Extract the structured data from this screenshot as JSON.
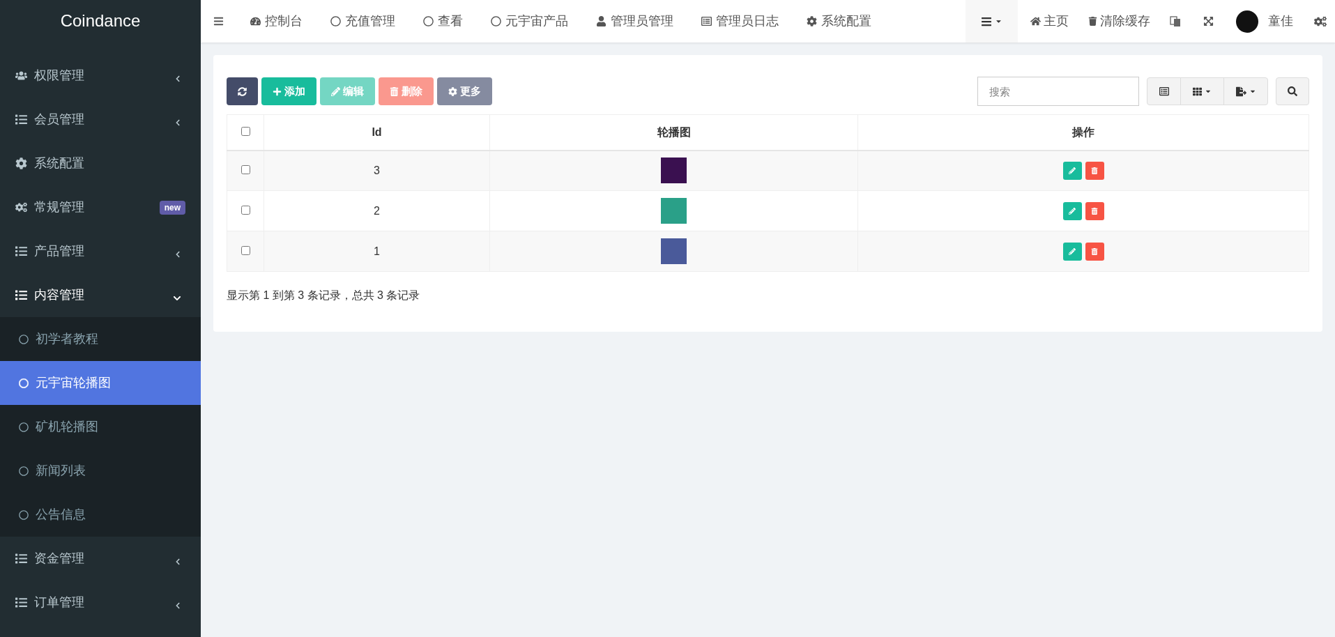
{
  "brand": "Coindance",
  "sidebar": {
    "items": [
      {
        "label": "权限管理",
        "expanded": false
      },
      {
        "label": "会员管理",
        "expanded": false
      },
      {
        "label": "系统配置"
      },
      {
        "label": "常规管理",
        "badge": "new"
      },
      {
        "label": "产品管理",
        "expanded": false
      },
      {
        "label": "内容管理",
        "expanded": true,
        "children": [
          {
            "label": "初学者教程",
            "selected": false
          },
          {
            "label": "元宇宙轮播图",
            "selected": true
          },
          {
            "label": "矿机轮播图",
            "selected": false
          },
          {
            "label": "新闻列表",
            "selected": false
          },
          {
            "label": "公告信息",
            "selected": false
          }
        ]
      },
      {
        "label": "资金管理",
        "expanded": false
      },
      {
        "label": "订单管理",
        "expanded": false
      }
    ]
  },
  "top_tabs": [
    "控制台",
    "充值管理",
    "查看",
    "元宇宙产品",
    "管理员管理",
    "管理员日志",
    "系统配置"
  ],
  "top_right": {
    "home": "主页",
    "clear_cache": "清除缓存",
    "user": "童佳"
  },
  "toolbar": {
    "buttons": [
      {
        "kind": "refresh"
      },
      {
        "kind": "add",
        "label": "添加",
        "disabled": false
      },
      {
        "kind": "edit",
        "label": "编辑",
        "disabled": true
      },
      {
        "kind": "delete",
        "label": "删除",
        "disabled": true
      },
      {
        "kind": "more",
        "label": "更多",
        "disabled": false
      }
    ],
    "search": {
      "placeholder": "搜索"
    }
  },
  "table": {
    "select_all_checked": false,
    "columns": [
      "Id",
      "轮播图",
      "操作"
    ],
    "rows": [
      {
        "checked": false,
        "id": "3"
      },
      {
        "checked": false,
        "id": "2"
      },
      {
        "checked": false,
        "id": "1"
      }
    ]
  },
  "pagination_info": "显示第 1 到第 3 条记录，总共 3 条记录"
}
